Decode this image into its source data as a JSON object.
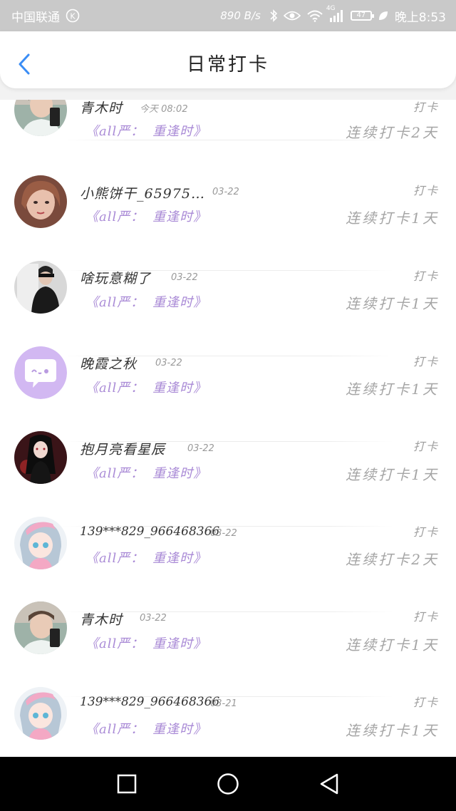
{
  "status_bar": {
    "carrier": "中国联通",
    "carrier_badge": "K",
    "speed": "890 B/s",
    "network": "4G",
    "battery": "47",
    "time": "晚上8:53",
    "icons": [
      "bluetooth-icon",
      "eye-icon",
      "wifi-icon",
      "signal-icon",
      "battery-icon",
      "leaf-icon"
    ]
  },
  "header": {
    "title": "日常打卡",
    "back_icon": "chevron-left-icon",
    "accent_color": "#3a8df5"
  },
  "list": {
    "checkin_label": "打卡",
    "items": [
      {
        "name": "青木时",
        "date": "今天 08:02",
        "book": "《all严：",
        "chapter": "重逢时》",
        "streak": "连续打卡2天",
        "avatar": "avatar-photo-boy"
      },
      {
        "name": "小熊饼干_65975…",
        "date": "03-22",
        "book": "《all严：",
        "chapter": "重逢时》",
        "streak": "连续打卡1天",
        "avatar": "avatar-photo-girl"
      },
      {
        "name": "啥玩意糊了",
        "date": "03-22",
        "book": "《all严：",
        "chapter": "重逢时》",
        "streak": "连续打卡1天",
        "avatar": "avatar-photo-dark"
      },
      {
        "name": "晚霞之秋",
        "date": "03-22",
        "book": "《all严：",
        "chapter": "重逢时》",
        "streak": "连续打卡1天",
        "avatar": "avatar-default-chat"
      },
      {
        "name": "抱月亮看星辰",
        "date": "03-22",
        "book": "《all严：",
        "chapter": "重逢时》",
        "streak": "连续打卡1天",
        "avatar": "avatar-anime-dark"
      },
      {
        "name": "139***829_966468366",
        "date": "03-22",
        "book": "《all严：",
        "chapter": "重逢时》",
        "streak": "连续打卡2天",
        "avatar": "avatar-anime-pink"
      },
      {
        "name": "青木时",
        "date": "03-22",
        "book": "《all严：",
        "chapter": "重逢时》",
        "streak": "连续打卡1天",
        "avatar": "avatar-photo-boy"
      },
      {
        "name": "139***829_966468366",
        "date": "03-21",
        "book": "《all严：",
        "chapter": "重逢时》",
        "streak": "连续打卡1天",
        "avatar": "avatar-anime-pink"
      }
    ]
  },
  "nav_bar": {
    "buttons": [
      "recent-apps-icon",
      "home-icon",
      "back-icon"
    ]
  }
}
